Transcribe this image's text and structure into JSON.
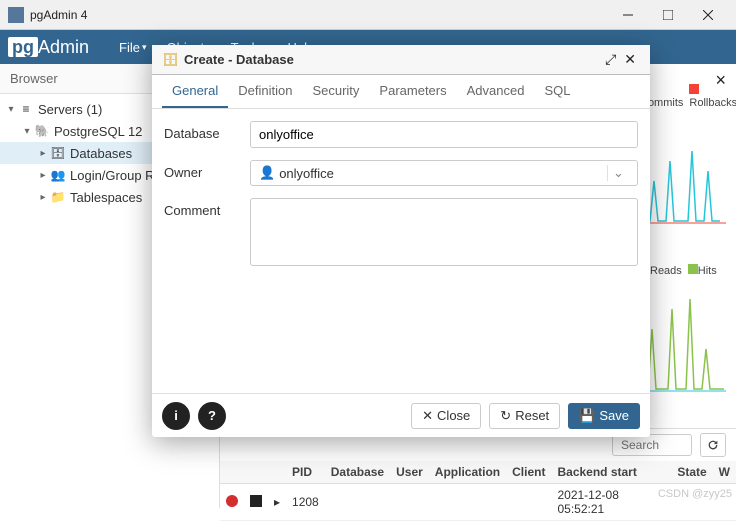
{
  "window": {
    "title": "pgAdmin 4"
  },
  "menubar": {
    "logo_pg": "pg",
    "logo_admin": "Admin",
    "items": [
      "File",
      "Object",
      "Tools",
      "Help"
    ]
  },
  "browser": {
    "title": "Browser",
    "tree": [
      {
        "label": "Servers (1)",
        "indent": 0,
        "caret": "▾",
        "icon": "servers",
        "sel": false
      },
      {
        "label": "PostgreSQL 12",
        "indent": 1,
        "caret": "▾",
        "icon": "pg",
        "sel": false
      },
      {
        "label": "Databases",
        "indent": 2,
        "caret": "▸",
        "icon": "db",
        "sel": true
      },
      {
        "label": "Login/Group R",
        "indent": 2,
        "caret": "▸",
        "icon": "roles",
        "sel": false
      },
      {
        "label": "Tablespaces",
        "indent": 2,
        "caret": "▸",
        "icon": "ts",
        "sel": false
      }
    ]
  },
  "dashboard": {
    "legend1": [
      {
        "color": "#8bc34a",
        "label": "Commits"
      },
      {
        "color": "#f44336",
        "label": "Rollbacks"
      }
    ],
    "legend2": [
      {
        "color": "#26c6da",
        "label": "Reads"
      },
      {
        "color": "#8bc34a",
        "label": "Hits"
      }
    ]
  },
  "sessions": {
    "search_placeholder": "Search",
    "columns": [
      "",
      "",
      "",
      "PID",
      "Database",
      "User",
      "Application",
      "Client",
      "Backend start",
      "State",
      "W"
    ],
    "rows": [
      {
        "pid": "1208",
        "database": "",
        "user": "",
        "application": "",
        "client": "",
        "backend_start": "2021-12-08 05:52:21",
        "state": ""
      }
    ]
  },
  "dialog": {
    "title": "Create - Database",
    "tabs": [
      "General",
      "Definition",
      "Security",
      "Parameters",
      "Advanced",
      "SQL"
    ],
    "active_tab": 0,
    "fields": {
      "database_label": "Database",
      "database_value": "onlyoffice",
      "owner_label": "Owner",
      "owner_value": "onlyoffice",
      "comment_label": "Comment",
      "comment_value": ""
    },
    "buttons": {
      "close": "Close",
      "reset": "Reset",
      "save": "Save"
    }
  },
  "watermark": "CSDN @zyy25"
}
